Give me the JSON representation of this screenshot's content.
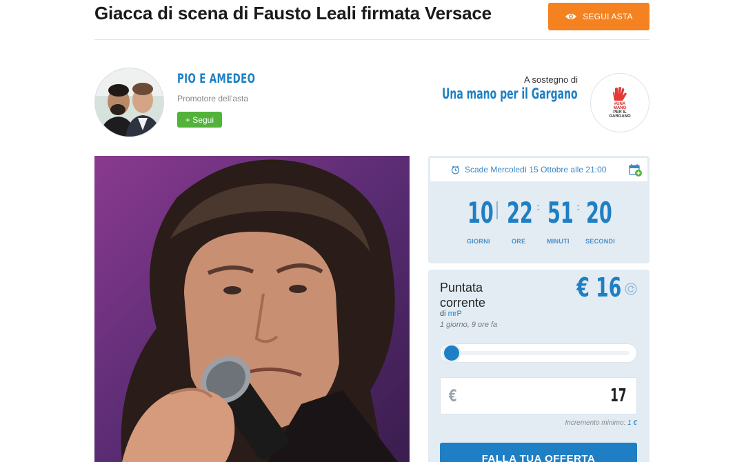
{
  "header": {
    "title": "Giacca di scena di Fausto Leali firmata Versace",
    "follow_button": "SEGUI ASTA"
  },
  "promoter": {
    "name": "PIO E AMEDEO",
    "role": "Promotore dell'asta",
    "follow_button": "+ Segui"
  },
  "charity": {
    "support_label": "A sostegno di",
    "name": "Una mano per il Gargano",
    "logo_lines": [
      "#UNA",
      "MANO",
      "PER IL",
      "GARGANO"
    ]
  },
  "countdown": {
    "deadline": "Scade Mercoledì 15 Ottobre alle 21:00",
    "days": "10",
    "hours": "22",
    "minutes": "51",
    "seconds": "20",
    "days_label": "GIORNI",
    "hours_label": "ORE",
    "minutes_label": "MINUTI",
    "seconds_label": "SECONDI"
  },
  "bid": {
    "title": "Puntata corrente",
    "by_prefix": "di",
    "bidder": "mrP",
    "time_ago": "1 giorno, 9 ore fa",
    "amount": "€ 16",
    "currency": "€",
    "input_value": "17",
    "min_increment_label": "Incremento minimo:",
    "min_increment_value": "1 €",
    "submit_label": "FALLA TUA OFFERTA"
  },
  "colors": {
    "accent_blue": "#1e7fc4",
    "orange": "#f58220",
    "green": "#52b23a",
    "panel_bg": "#e3ecf3"
  }
}
